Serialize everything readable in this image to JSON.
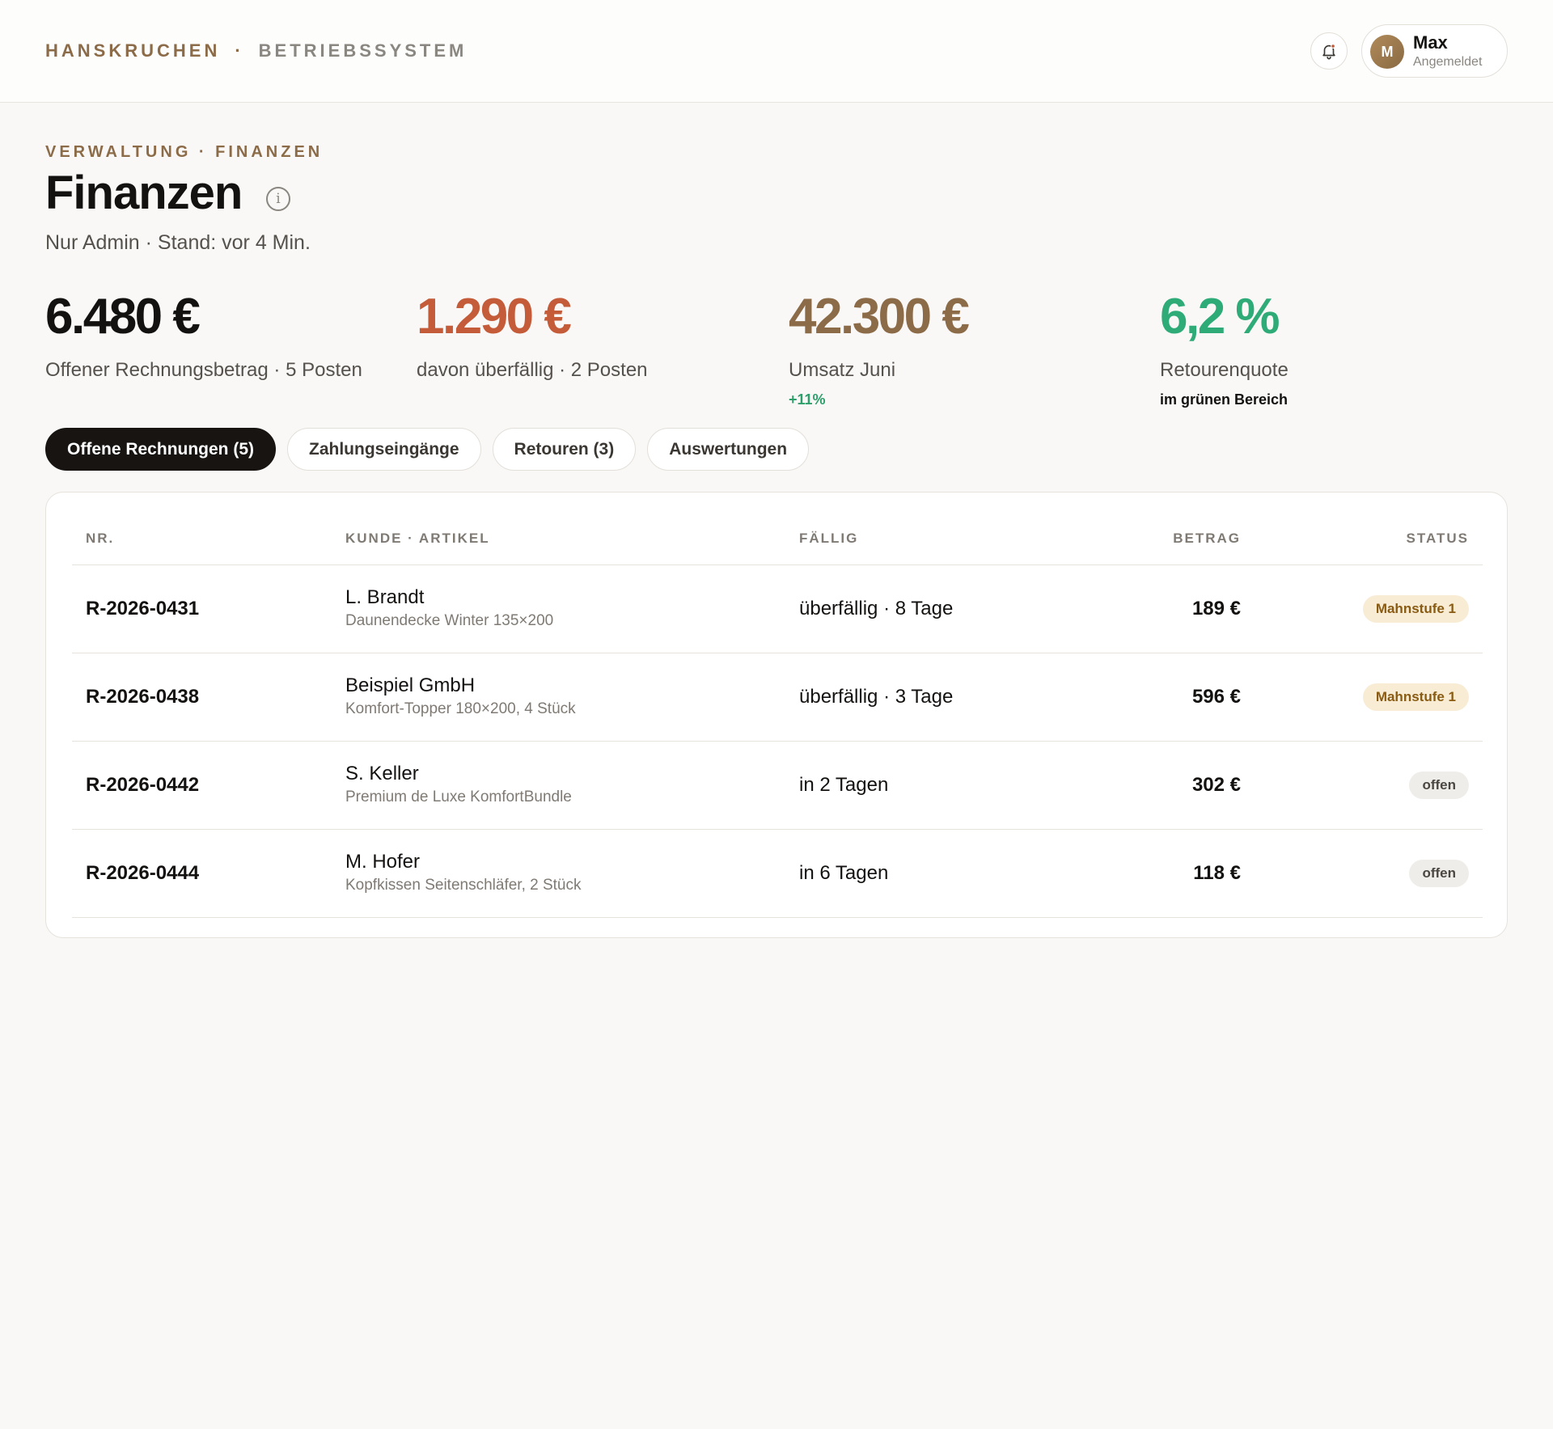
{
  "topbar": {
    "brand": "HANSKRUCHEN",
    "separator": "·",
    "system": "BETRIEBSSYSTEM",
    "bell_icon": "bell-icon",
    "user": {
      "initial": "M",
      "name": "Max",
      "status": "Angemeldet"
    }
  },
  "header": {
    "breadcrumb": "VERWALTUNG · FINANZEN",
    "title": "Finanzen",
    "info_icon": "i",
    "subtitle": "Nur Admin · Stand: vor 4 Min."
  },
  "kpis": [
    {
      "value": "6.480 €",
      "label": "Offener Rechnungsbetrag · 5 Posten",
      "note": "",
      "color": "#141210"
    },
    {
      "value": "1.290 €",
      "label": "davon überfällig · 2 Posten",
      "note": "",
      "color": "#c45c3a"
    },
    {
      "value": "42.300 €",
      "label": "Umsatz Juni",
      "note": "+11%",
      "color": "#8c6b48",
      "note_color": "#2e9e6b"
    },
    {
      "value": "6,2 %",
      "label": "Retourenquote",
      "note": "im grünen Bereich",
      "color": "#2fab78",
      "note_color": "#141210"
    }
  ],
  "tabs": [
    {
      "label": "Offene Rechnungen (5)",
      "active": true
    },
    {
      "label": "Zahlungseingänge",
      "active": false
    },
    {
      "label": "Retouren (3)",
      "active": false
    },
    {
      "label": "Auswertungen",
      "active": false
    }
  ],
  "table": {
    "columns": {
      "nr": "NR.",
      "kunde": "KUNDE · ARTIKEL",
      "faellig": "FÄLLIG",
      "betrag": "BETRAG",
      "status": "STATUS"
    },
    "rows": [
      {
        "nr": "R-2026-0431",
        "kunde": "L. Brandt",
        "artikel": "Daunendecke Winter 135×200",
        "faellig": "überfällig · 8 Tage",
        "betrag": "189 €",
        "status": "Mahnstufe 1"
      },
      {
        "nr": "R-2026-0438",
        "kunde": "Beispiel GmbH",
        "artikel": "Komfort-Topper 180×200, 4 Stück",
        "faellig": "überfällig · 3 Tage",
        "betrag": "596 €",
        "status": "Mahnstufe 1"
      },
      {
        "nr": "R-2026-0442",
        "kunde": "S. Keller",
        "artikel": "Premium de Luxe KomfortBundle",
        "faellig": "in 2 Tagen",
        "betrag": "302 €",
        "status": "offen"
      },
      {
        "nr": "R-2026-0444",
        "kunde": "M. Hofer",
        "artikel": "Kopfkissen Seitenschläfer, 2 Stück",
        "faellig": "in 6 Tagen",
        "betrag": "118 €",
        "status": "offen"
      }
    ]
  }
}
